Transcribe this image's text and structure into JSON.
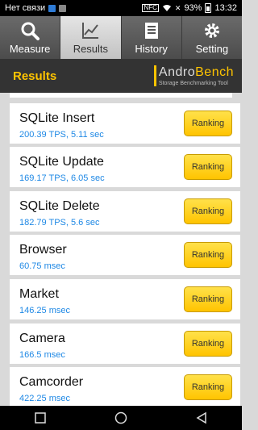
{
  "status_bar": {
    "carrier": "Нет связи",
    "battery": "93%",
    "time": "13:32",
    "nfc": "NFC"
  },
  "tabs": [
    {
      "label": "Measure",
      "icon": "search-icon"
    },
    {
      "label": "Results",
      "icon": "chart-icon"
    },
    {
      "label": "History",
      "icon": "list-icon"
    },
    {
      "label": "Setting",
      "icon": "gear-icon"
    }
  ],
  "header": {
    "title": "Results",
    "logo_main_a": "Andro",
    "logo_main_b": "Bench",
    "logo_sub": "Storage Benchmarking Tool"
  },
  "results": [
    {
      "name": "SQLite Insert",
      "value": "200.39 TPS, 5.11 sec",
      "button": "Ranking"
    },
    {
      "name": "SQLite Update",
      "value": "169.17 TPS, 6.05 sec",
      "button": "Ranking"
    },
    {
      "name": "SQLite Delete",
      "value": "182.79 TPS, 5.6 sec",
      "button": "Ranking"
    },
    {
      "name": "Browser",
      "value": "60.75 msec",
      "button": "Ranking"
    },
    {
      "name": "Market",
      "value": "146.25 msec",
      "button": "Ranking"
    },
    {
      "name": "Camera",
      "value": "166.5 msec",
      "button": "Ranking"
    },
    {
      "name": "Camcorder",
      "value": "422.25 msec",
      "button": "Ranking"
    }
  ],
  "colors": {
    "accent": "#ffc400",
    "value_text": "#1e88e5",
    "header_bg": "#333333"
  }
}
